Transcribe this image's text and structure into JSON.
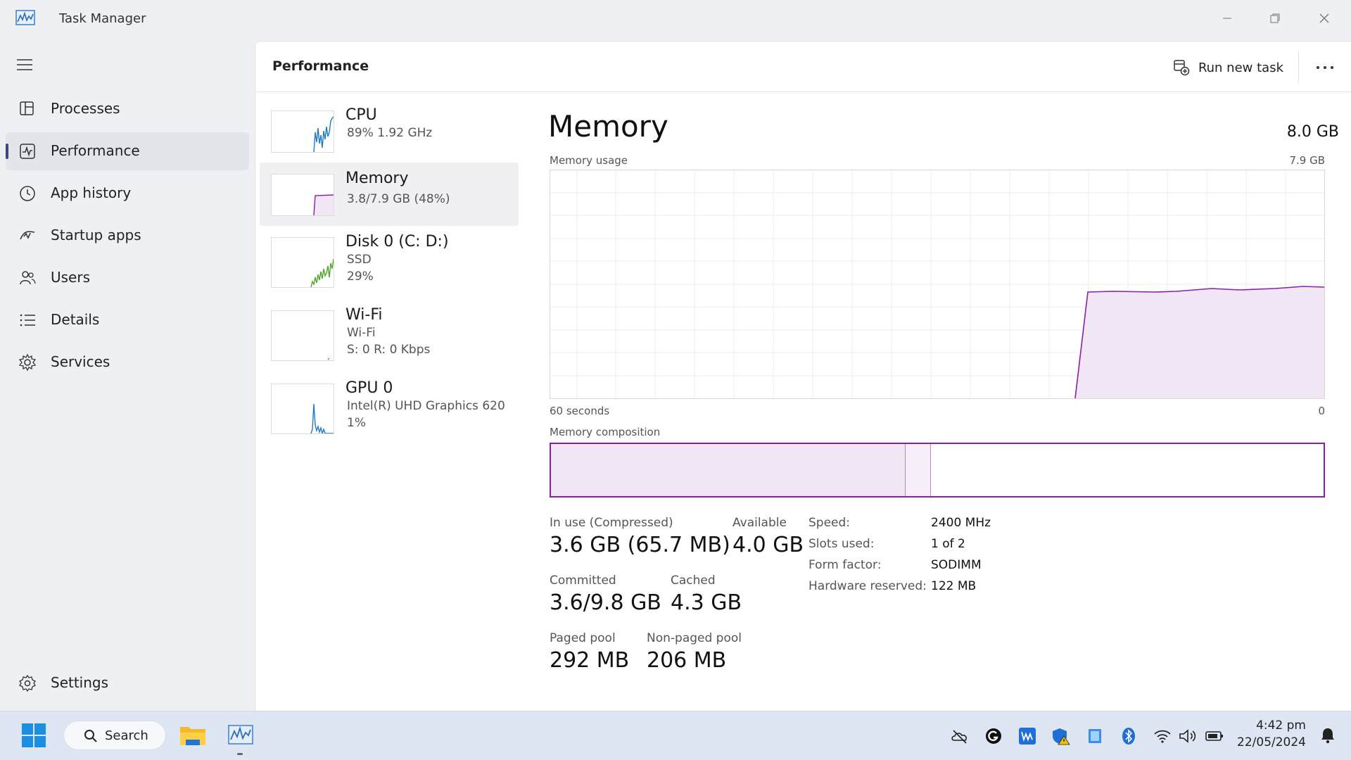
{
  "window": {
    "title": "Task Manager"
  },
  "sidebar": {
    "items": [
      {
        "label": "Processes",
        "icon": "processes-icon"
      },
      {
        "label": "Performance",
        "icon": "performance-icon",
        "active": true
      },
      {
        "label": "App history",
        "icon": "app-history-icon"
      },
      {
        "label": "Startup apps",
        "icon": "startup-apps-icon"
      },
      {
        "label": "Users",
        "icon": "users-icon"
      },
      {
        "label": "Details",
        "icon": "details-icon"
      },
      {
        "label": "Services",
        "icon": "services-icon"
      }
    ],
    "settings_label": "Settings"
  },
  "header": {
    "title": "Performance",
    "run_new_task": "Run new task"
  },
  "resources": [
    {
      "name": "CPU",
      "line1": "89%  1.92 GHz",
      "line2": "",
      "color": "#1f7bc1"
    },
    {
      "name": "Memory",
      "line1": "3.8/7.9 GB (48%)",
      "line2": "",
      "color": "#8b1fa9",
      "selected": true
    },
    {
      "name": "Disk 0 (C: D:)",
      "line1": "SSD",
      "line2": "29%",
      "color": "#4ca82b"
    },
    {
      "name": "Wi-Fi",
      "line1": "Wi-Fi",
      "line2": "S: 0  R: 0 Kbps",
      "color": "#c44b28"
    },
    {
      "name": "GPU 0",
      "line1": "Intel(R) UHD Graphics 620",
      "line2": "1%",
      "color": "#1f7bc1"
    }
  ],
  "memory": {
    "title": "Memory",
    "total": "8.0 GB",
    "usage_label": "Memory usage",
    "usage_max": "7.9 GB",
    "axis_left": "60 seconds",
    "axis_right": "0",
    "composition_label": "Memory composition",
    "stats": {
      "in_use_label": "In use (Compressed)",
      "in_use_value": "3.6 GB (65.7 MB)",
      "available_label": "Available",
      "available_value": "4.0 GB",
      "committed_label": "Committed",
      "committed_value": "3.6/9.8 GB",
      "cached_label": "Cached",
      "cached_value": "4.3 GB",
      "paged_label": "Paged pool",
      "paged_value": "292 MB",
      "nonpaged_label": "Non-paged pool",
      "nonpaged_value": "206 MB"
    },
    "props": [
      {
        "label": "Speed:",
        "value": "2400 MHz"
      },
      {
        "label": "Slots used:",
        "value": "1 of 2"
      },
      {
        "label": "Form factor:",
        "value": "SODIMM"
      },
      {
        "label": "Hardware reserved:",
        "value": "122 MB"
      }
    ],
    "accent": "#8b1fa9"
  },
  "taskbar": {
    "search_label": "Search",
    "time": "4:42 pm",
    "date": "22/05/2024"
  }
}
